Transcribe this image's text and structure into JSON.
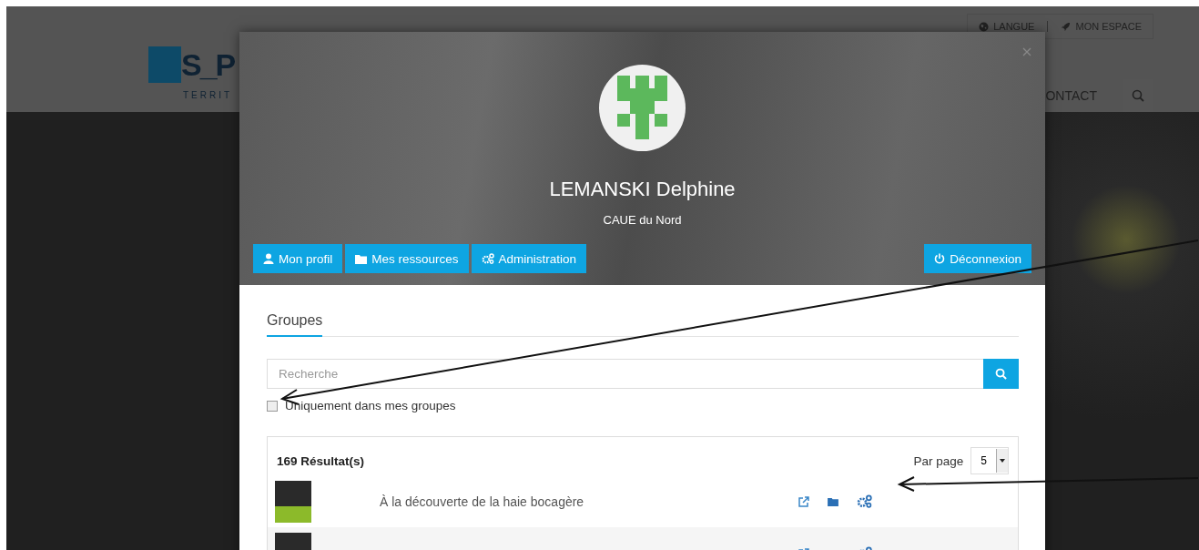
{
  "site": {
    "logo_mark": "S_P",
    "logo_subtitle": "TERRIT",
    "top_links": [
      {
        "label": "LANGUE",
        "kind": "globe"
      },
      {
        "label": "MON ESPACE",
        "kind": "rocket"
      }
    ],
    "nav_item": "ONTACT"
  },
  "modal": {
    "user_name": "LEMANSKI Delphine",
    "organization": "CAUE du Nord",
    "actions": [
      {
        "label": "Mon profil",
        "kind": "user"
      },
      {
        "label": "Mes ressources",
        "kind": "folder"
      },
      {
        "label": "Administration",
        "kind": "gears"
      }
    ],
    "logout": {
      "label": "Déconnexion"
    },
    "tabs": [
      {
        "label": "Groupes",
        "selected": true
      }
    ],
    "search": {
      "placeholder": "Recherche"
    },
    "filter": {
      "label": "Uniquement dans mes groupes",
      "checked": false
    },
    "results": {
      "count": "169 Résultat(s)",
      "per_page_label": "Par page",
      "per_page_value": "5",
      "rows": [
        {
          "name": "À la découverte de la haie bocagère",
          "shaded": false
        },
        {
          "shaded": true
        }
      ]
    }
  }
}
